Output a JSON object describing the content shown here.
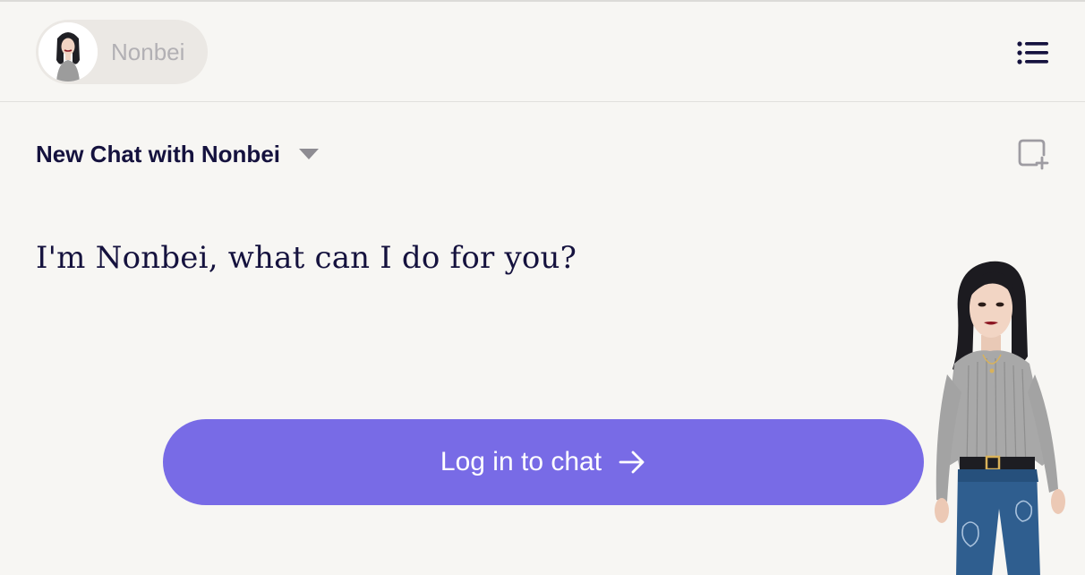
{
  "topbar": {
    "agent_name": "Nonbei",
    "avatar_icon": "nonbei-avatar-icon",
    "menu_icon": "list-menu-icon"
  },
  "chat": {
    "title": "New Chat with Nonbei",
    "dropdown_icon": "caret-down-icon",
    "new_chat_icon": "new-chat-icon",
    "greeting": "I'm Nonbei, what can I do for you?"
  },
  "login": {
    "label": "Log in to chat",
    "icon": "arrow-right-icon"
  },
  "colors": {
    "background": "#f7f6f3",
    "pill": "#ebe8e4",
    "accent": "#786be6",
    "text_dark": "#15123e",
    "text_muted": "#b2b0b4"
  }
}
